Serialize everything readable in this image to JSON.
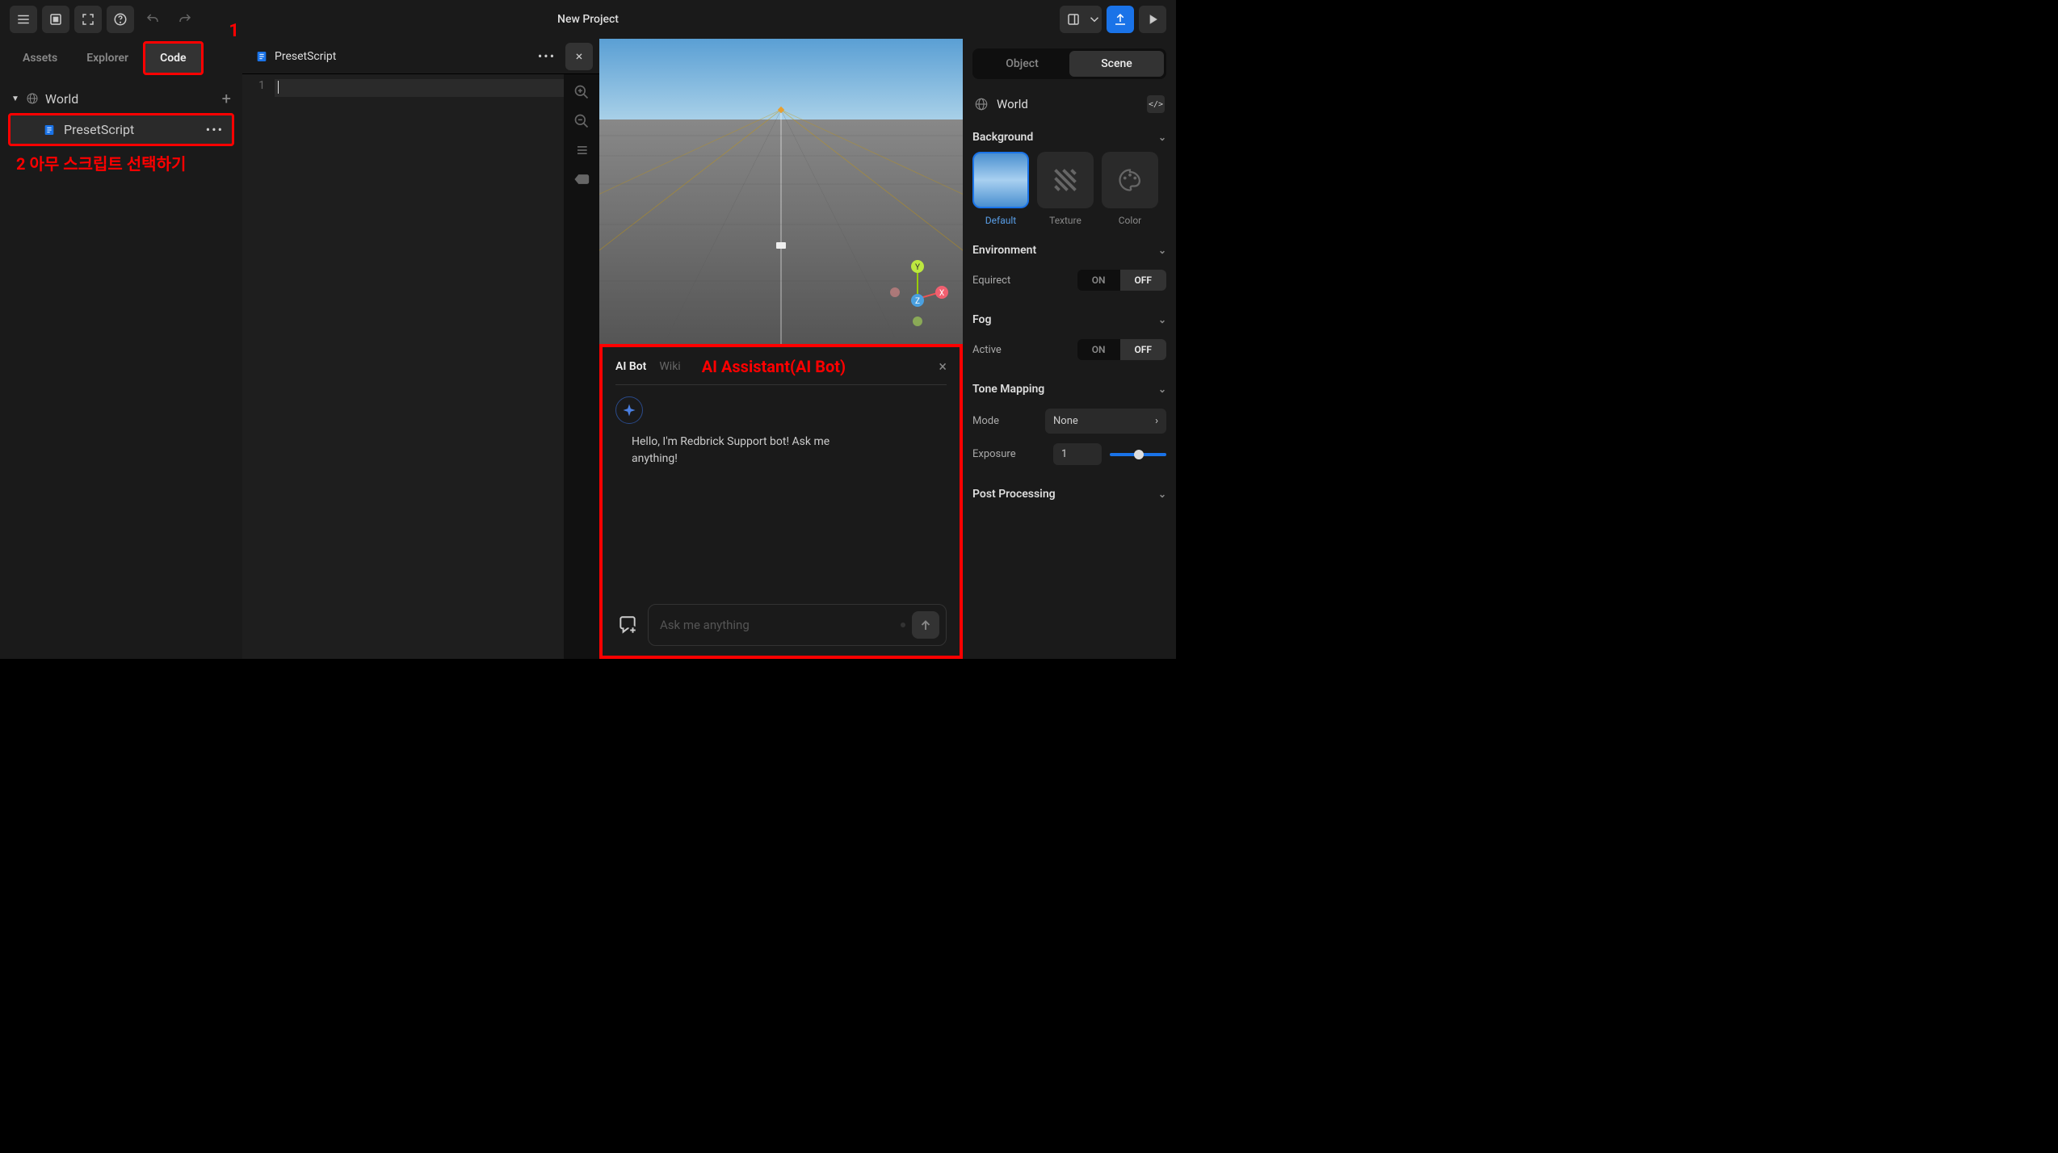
{
  "topbar": {
    "title": "New Project"
  },
  "left": {
    "tabs": {
      "assets": "Assets",
      "explorer": "Explorer",
      "code": "Code"
    },
    "annotation1": "1",
    "world_label": "World",
    "script_label": "PresetScript",
    "annotation2": "2 아무 스크립트 선택하기"
  },
  "editor": {
    "tab_label": "PresetScript",
    "line_number": "1"
  },
  "ai": {
    "tab_bot": "AI Bot",
    "tab_wiki": "Wiki",
    "annotation": "AI Assistant(AI Bot)",
    "greeting": "Hello, I'm Redbrick Support bot! Ask me anything!",
    "placeholder": "Ask me anything"
  },
  "inspector": {
    "tabs": {
      "object": "Object",
      "scene": "Scene"
    },
    "world_label": "World",
    "background": {
      "title": "Background",
      "default": "Default",
      "texture": "Texture",
      "color": "Color"
    },
    "environment": {
      "title": "Environment",
      "equirect": "Equirect",
      "on": "ON",
      "off": "OFF"
    },
    "fog": {
      "title": "Fog",
      "active": "Active",
      "on": "ON",
      "off": "OFF"
    },
    "tone": {
      "title": "Tone Mapping",
      "mode_label": "Mode",
      "mode_value": "None",
      "exposure_label": "Exposure",
      "exposure_value": "1"
    },
    "post": {
      "title": "Post Processing"
    }
  }
}
